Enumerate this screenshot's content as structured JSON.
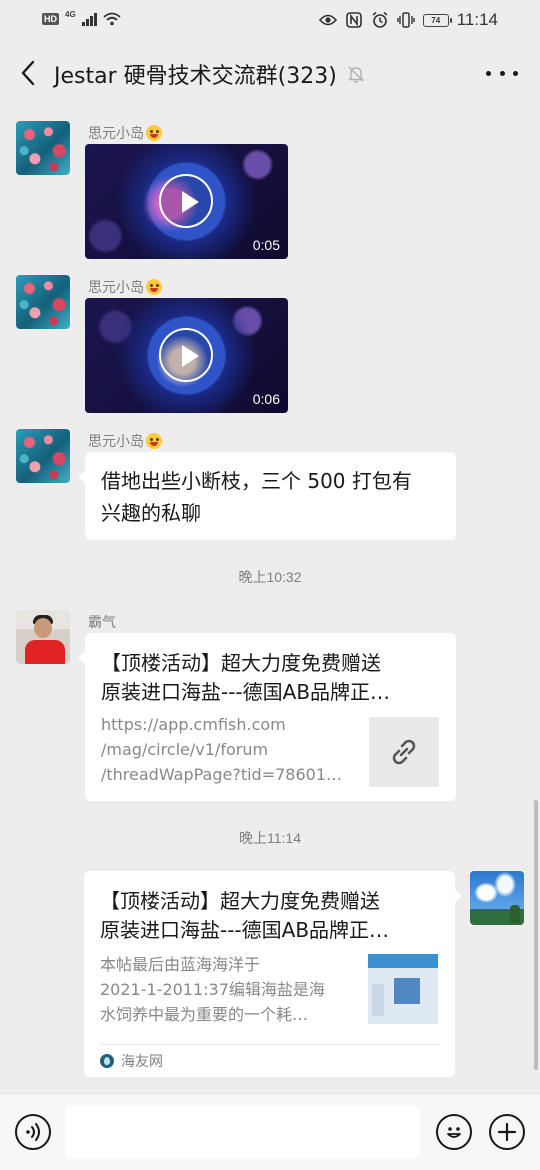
{
  "status_bar": {
    "hd": "HD",
    "network": "4G",
    "battery": "74",
    "time": "11:14"
  },
  "header": {
    "title": "Jestar 硬骨技术交流群(323)",
    "back_icon": "back-chevron-icon",
    "mute_icon": "bell-off-icon",
    "more_icon": "more-dots-icon"
  },
  "messages": [
    {
      "type": "video",
      "sender": "思元小岛",
      "duration": "0:05"
    },
    {
      "type": "video",
      "sender": "思元小岛",
      "duration": "0:06"
    },
    {
      "type": "text",
      "sender": "思元小岛",
      "lines": [
        "借地出些小断枝，三个 500 打包有",
        "兴趣的私聊"
      ]
    },
    {
      "type": "time",
      "text": "晚上10:32"
    },
    {
      "type": "link",
      "sender": "霸气",
      "title_lines": [
        "【顶楼活动】超大力度免费赠送",
        "原装进口海盐---德国AB品牌正…"
      ],
      "desc_lines": [
        "https://app.cmfish.com",
        "/mag/circle/v1/forum",
        "/threadWapPage?tid=78601…"
      ],
      "thumb_icon": "link-icon"
    },
    {
      "type": "time",
      "text": "晚上11:14"
    },
    {
      "type": "link",
      "sender": "",
      "title_lines": [
        "【顶楼活动】超大力度免费赠送",
        "原装进口海盐---德国AB品牌正…"
      ],
      "desc_lines": [
        "本帖最后由蓝海海洋于",
        "2021-1-2011:37编辑海盐是海",
        "水饲养中最为重要的一个耗…"
      ],
      "source": "海友网"
    }
  ],
  "input_bar": {
    "voice_icon": "voice-icon",
    "emoji_icon": "emoji-icon",
    "plus_icon": "plus-icon",
    "value": ""
  },
  "colors": {
    "background": "#ededed",
    "bubble": "#ffffff",
    "text": "#191919",
    "meta": "#7f7f7f"
  }
}
